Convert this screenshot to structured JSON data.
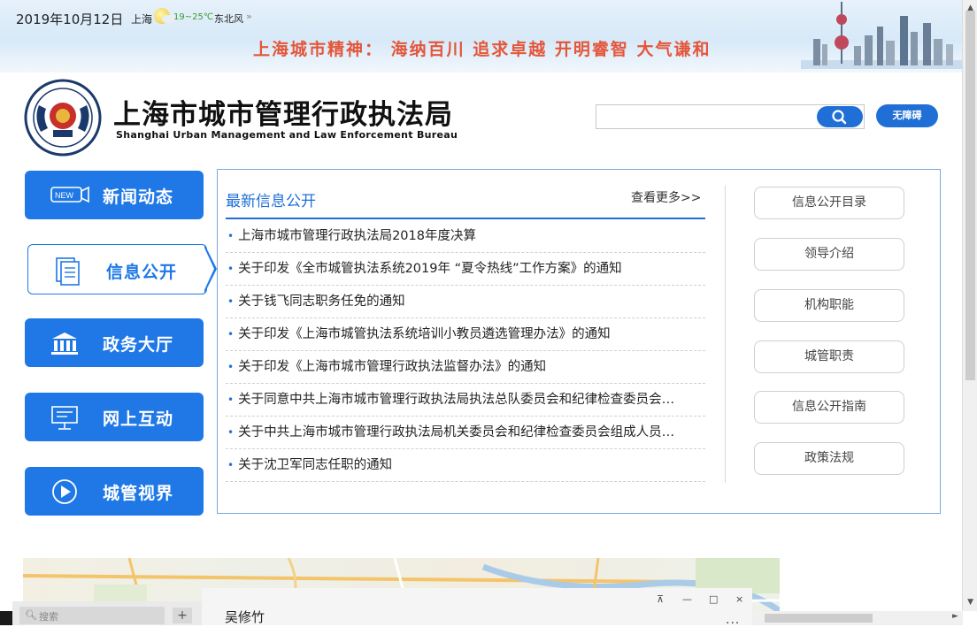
{
  "banner": {
    "date": "2019年10月12日",
    "city": "上海",
    "temperature": "19~25℃",
    "wind": "东北风",
    "wind_more": "»",
    "spirit": "上海城市精神：  海纳百川  追求卓越  开明睿智  大气谦和"
  },
  "header": {
    "org_name_cn": "上海市城市管理行政执法局",
    "org_name_en": "Shanghai Urban Management and Law Enforcement Bureau",
    "search_value": "",
    "accessibility_label": "无障碍"
  },
  "nav": {
    "items": [
      {
        "label": "新闻动态",
        "icon": "new-badge-icon",
        "active": false
      },
      {
        "label": "信息公开",
        "icon": "document-icon",
        "active": true
      },
      {
        "label": "政务大厅",
        "icon": "building-icon",
        "active": false
      },
      {
        "label": "网上互动",
        "icon": "monitor-chat-icon",
        "active": false
      },
      {
        "label": "城管视界",
        "icon": "play-icon",
        "active": false
      }
    ]
  },
  "panel": {
    "title": "最新信息公开",
    "more": "查看更多>>",
    "news": [
      "上海市城市管理行政执法局2018年度决算",
      "关于印发《全市城管执法系统2019年 “夏令热线”工作方案》的通知",
      "关于钱飞同志职务任免的通知",
      "关于印发《上海市城管执法系统培训小教员遴选管理办法》的通知",
      "关于印发《上海市城市管理行政执法监督办法》的通知",
      "关于同意中共上海市城市管理行政执法局执法总队委员会和纪律检查委员会…",
      "关于中共上海市城市管理行政执法局机关委员会和纪律检查委员会组成人员…",
      "关于沈卫军同志任职的通知"
    ],
    "side_buttons": [
      "信息公开目录",
      "领导介绍",
      "机构职能",
      "城管职责",
      "信息公开指南",
      "政策法规"
    ]
  },
  "chat": {
    "search_placeholder": "搜索",
    "plus": "+",
    "contact_name": "吴修竹",
    "more": "...",
    "pin": "⊼",
    "minimize": "—",
    "maximize": "□",
    "close": "×"
  },
  "colors": {
    "brand_blue": "#1f78e6",
    "spirit_red": "#e4563a"
  }
}
